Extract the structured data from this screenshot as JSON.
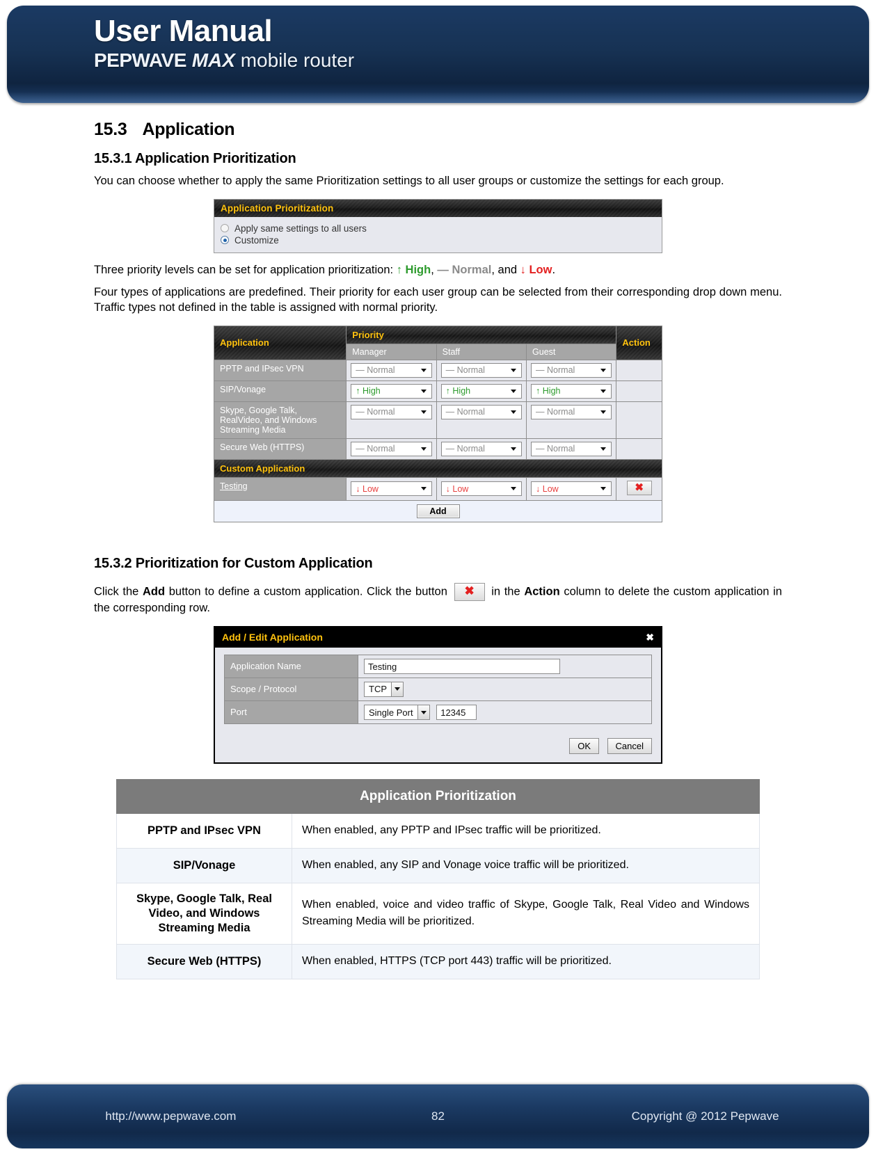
{
  "header": {
    "title": "User Manual",
    "brand_bold": "PEPWAVE",
    "brand_italic": "MAX",
    "brand_normal": "mobile router"
  },
  "section": {
    "number": "15.3",
    "title": "Application",
    "sub1_title": "15.3.1 Application Prioritization",
    "sub1_paragraph": "You can choose whether to apply the same Prioritization settings to all user groups or customize the settings for each group.",
    "priority_intro": "Three priority levels can be set for application prioritization:",
    "priority_high": "↑ High",
    "priority_comma1": ",",
    "priority_normal": "— Normal",
    "priority_and": ", and",
    "priority_low": "↓ Low",
    "priority_period": ".",
    "predefined_paragraph": "Four types of applications are predefined. Their priority for each user group can be selected from their corresponding drop down menu. Traffic types not defined in the table is assigned with normal priority.",
    "sub2_title": "15.3.2 Prioritization for Custom Application",
    "custom_para_1": "Click  the",
    "custom_para_add": "Add",
    "custom_para_2": "button  to  define  a  custom  application. Click  the  button",
    "custom_para_3": "in  the",
    "custom_para_action": "Action",
    "custom_para_4": "column  to delete the custom application in the corresponding row."
  },
  "prioritization_panel": {
    "title": "Application Prioritization",
    "options": [
      {
        "label": "Apply same settings to all users",
        "selected": false
      },
      {
        "label": "Customize",
        "selected": true
      }
    ]
  },
  "priority_table": {
    "col_application": "Application",
    "col_priority": "Priority",
    "col_action": "Action",
    "groups": [
      "Manager",
      "Staff",
      "Guest"
    ],
    "custom_header": "Custom Application",
    "add_label": "Add",
    "rows": [
      {
        "application": "PPTP and IPsec VPN",
        "values": [
          "— Normal",
          "— Normal",
          "— Normal"
        ],
        "level": "normal"
      },
      {
        "application": "SIP/Vonage",
        "values": [
          "↑ High",
          "↑ High",
          "↑ High"
        ],
        "level": "high"
      },
      {
        "application": "Skype, Google Talk, RealVideo, and Windows Streaming Media",
        "values": [
          "— Normal",
          "— Normal",
          "— Normal"
        ],
        "level": "normal"
      },
      {
        "application": "Secure Web (HTTPS)",
        "values": [
          "— Normal",
          "— Normal",
          "— Normal"
        ],
        "level": "normal"
      }
    ],
    "custom_rows": [
      {
        "application": "Testing",
        "values": [
          "↓ Low",
          "↓ Low",
          "↓ Low"
        ],
        "level": "low",
        "action_icon": "delete-icon"
      }
    ]
  },
  "dialog": {
    "title": "Add / Edit Application",
    "close_icon": "✖",
    "fields": [
      {
        "label": "Application Name",
        "value": "Testing"
      },
      {
        "label": "Scope / Protocol",
        "value": "TCP"
      },
      {
        "label": "Port",
        "value": "Single Port",
        "extra": "12345"
      }
    ],
    "ok_label": "OK",
    "cancel_label": "Cancel"
  },
  "description_table": {
    "title": "Application Prioritization",
    "rows": [
      {
        "key": "PPTP and IPsec VPN",
        "value": "When enabled, any PPTP and IPsec traffic will be prioritized."
      },
      {
        "key": "SIP/Vonage",
        "value": "When enabled, any SIP and Vonage voice traffic will be prioritized."
      },
      {
        "key": "Skype, Google Talk, Real Video, and Windows Streaming Media",
        "value": "When enabled, voice and video traffic of Skype, Google Talk, Real Video and Windows Streaming Media will be prioritized."
      },
      {
        "key": "Secure Web (HTTPS)",
        "value": "When enabled, HTTPS (TCP port 443) traffic will be prioritized."
      }
    ]
  },
  "footer": {
    "url": "http://www.pepwave.com",
    "page": "82",
    "copyright": "Copyright @ 2012 Pepwave"
  }
}
